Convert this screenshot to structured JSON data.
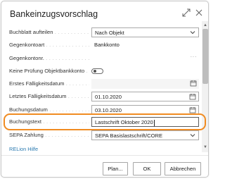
{
  "dialog": {
    "title": "Bankeinzugsvorschlag"
  },
  "fields": {
    "buchblatt": {
      "label": "Buchblatt aufteilen",
      "value": "Nach Objekt"
    },
    "gegenkontoart": {
      "label": "Gegenkontoart",
      "value": "Bankkonto"
    },
    "gegenkontonr": {
      "label": "Gegenkontonr.",
      "value": ""
    },
    "keine_pruefung": {
      "label": "Keine Prüfung Objektbankkonto",
      "value": "off"
    },
    "erstes_faellig": {
      "label": "Erstes Fälligkeitsdatum",
      "value": ""
    },
    "letztes_faellig": {
      "label": "Letztes Fälligkeitsdatum",
      "value": "01.10.2020"
    },
    "buchungsdatum": {
      "label": "Buchungsdatum",
      "value": "03.10.2020"
    },
    "buchungstext": {
      "label": "Buchungstext",
      "value": "Lastschrift Oktober 2020"
    },
    "sepa": {
      "label": "SEPA Zahlung",
      "value": "SEPA Basislastschrift/CORE"
    }
  },
  "help_link": "RELion Hilfe",
  "buttons": {
    "plan": "Plan...",
    "ok": "OK",
    "cancel": "Abbrechen"
  },
  "colors": {
    "highlight": "#f08b21",
    "link": "#2a7ab0"
  }
}
